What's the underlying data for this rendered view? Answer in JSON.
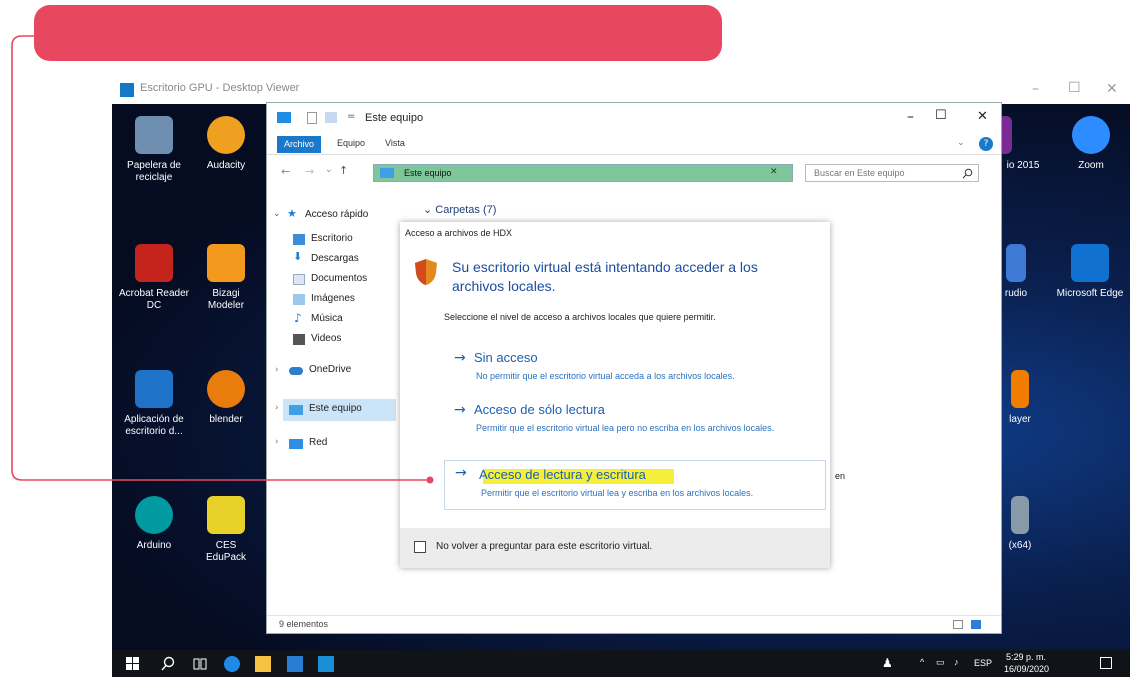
{
  "viewer": {
    "title": "Escritorio GPU - Desktop Viewer",
    "minimize": "–",
    "maximize": "☐",
    "close": "✕"
  },
  "desktop_icons": [
    {
      "label": "Papelera de reciclaje",
      "color": "#6e8fb0"
    },
    {
      "label": "Audacity",
      "color": "#f0a020"
    },
    {
      "label": "Acrobat Reader DC",
      "color": "#c4241c"
    },
    {
      "label": "Bizagi Modeler",
      "color": "#f39a1e"
    },
    {
      "label": "Aplicación de escritorio d...",
      "color": "#1e73c8"
    },
    {
      "label": "blender",
      "color": "#e87d0d"
    },
    {
      "label": "Arduino",
      "color": "#009aa0"
    },
    {
      "label": "CES EduPack",
      "color": "#e8d22a"
    },
    {
      "label": "io 2015",
      "color": "#7a2b93"
    },
    {
      "label": "Zoom",
      "color": "#2d8cff"
    },
    {
      "label": "Microsoft Edge",
      "color": "#1171d1"
    },
    {
      "label": "rudio",
      "color": "#3d7ad6"
    },
    {
      "label": "layer",
      "color": "#f07c00"
    },
    {
      "label": "(x64)",
      "color": "#8899aa"
    }
  ],
  "explorer": {
    "title": "Este equipo",
    "ribbon": {
      "active": "Archivo",
      "items": [
        "Equipo",
        "Vista"
      ]
    },
    "address": "Este equipo",
    "search_placeholder": "Buscar en Este equipo",
    "folders_header": "Carpetas (7)",
    "nav": {
      "quick_access": "Acceso rápido",
      "items": [
        "Escritorio",
        "Descargas",
        "Documentos",
        "Imágenes",
        "Música",
        "Videos"
      ],
      "onedrive": "OneDrive",
      "this_pc": "Este equipo",
      "network": "Red"
    },
    "status": "9 elementos",
    "partial_text": "en"
  },
  "dialog": {
    "header": "Acceso a archivos de HDX",
    "question": "Su escritorio virtual está intentando acceder a los archivos locales.",
    "instruction": "Seleccione el nivel de acceso a archivos locales que quiere permitir.",
    "options": [
      {
        "label": "Sin acceso",
        "desc": "No permitir que el escritorio virtual acceda a los archivos locales."
      },
      {
        "label": "Acceso de sólo lectura",
        "desc": "Permitir que el escritorio virtual lea pero no escriba en los archivos locales."
      },
      {
        "label": "Acceso de lectura y escritura",
        "desc": "Permitir que el escritorio virtual lea y escriba en los archivos locales."
      }
    ],
    "checkbox_label": "No volver a preguntar para este escritorio virtual."
  },
  "taskbar": {
    "lang": "ESP",
    "time": "5:29 p. m.",
    "date": "16/09/2020"
  },
  "colors": {
    "banner": "#e8485f",
    "accent": "#1a5fb4",
    "highlight": "#f6ef3a",
    "address_bar": "#7fc79a"
  }
}
